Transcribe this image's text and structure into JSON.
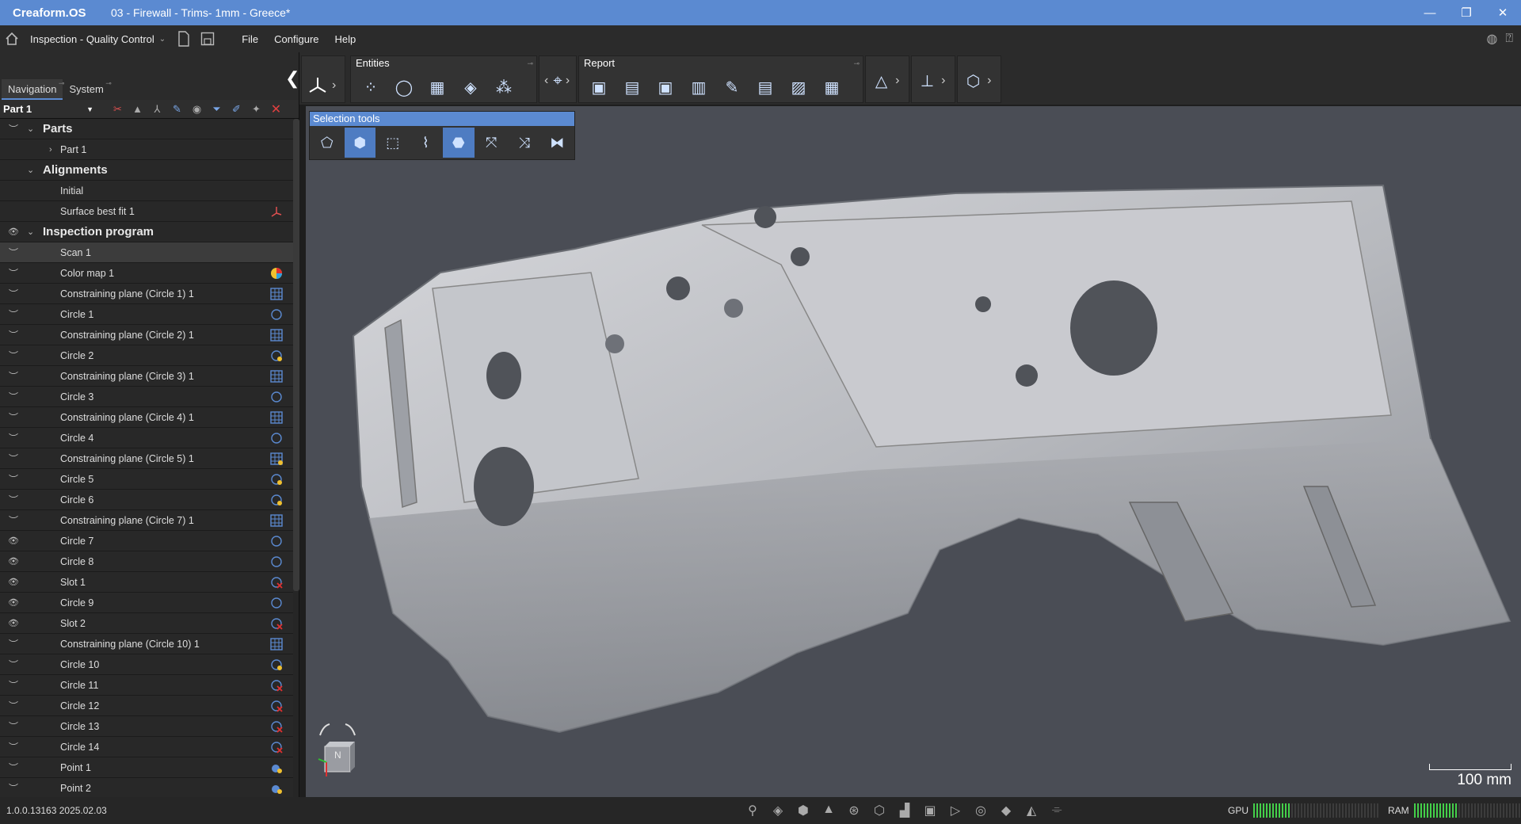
{
  "window": {
    "app_name": "Creaform.OS",
    "doc_title": "03 - Firewall - Trims- 1mm - Greece*",
    "minimize": "—",
    "maximize": "❐",
    "close": "✕"
  },
  "menubar": {
    "workspace": "Inspection - Quality Control",
    "items": [
      "File",
      "Configure",
      "Help"
    ]
  },
  "panel": {
    "tabs": [
      "Navigation",
      "System"
    ],
    "part_select": "Part 1"
  },
  "tree": [
    {
      "label": "Parts",
      "type": "group",
      "eye": "hidden",
      "chev": "down",
      "indent": 0
    },
    {
      "label": "Part 1",
      "type": "item",
      "eye": "none",
      "chev": "right",
      "indent": 1
    },
    {
      "label": "Alignments",
      "type": "group",
      "eye": "none",
      "chev": "down",
      "indent": 0
    },
    {
      "label": "Initial",
      "type": "item",
      "eye": "none",
      "indent": 1
    },
    {
      "label": "Surface best fit 1",
      "type": "item",
      "eye": "none",
      "indent": 1,
      "icon": "axes-icon"
    },
    {
      "label": "Inspection program",
      "type": "group",
      "eye": "visible",
      "chev": "down",
      "indent": 0
    },
    {
      "label": "Scan 1",
      "type": "item",
      "eye": "hidden",
      "indent": 1,
      "selected": true
    },
    {
      "label": "Color map 1",
      "type": "item",
      "eye": "hidden",
      "indent": 1,
      "icon": "color-map-icon"
    },
    {
      "label": "Constraining plane (Circle 1) 1",
      "type": "item",
      "eye": "hidden",
      "indent": 1,
      "icon": "plane-icon"
    },
    {
      "label": "Circle 1",
      "type": "item",
      "eye": "hidden",
      "indent": 1,
      "icon": "circle-icon"
    },
    {
      "label": "Constraining plane (Circle 2) 1",
      "type": "item",
      "eye": "hidden",
      "indent": 1,
      "icon": "plane-icon"
    },
    {
      "label": "Circle 2",
      "type": "item",
      "eye": "hidden",
      "indent": 1,
      "icon": "circle-warn-icon"
    },
    {
      "label": "Constraining plane (Circle 3) 1",
      "type": "item",
      "eye": "hidden",
      "indent": 1,
      "icon": "plane-icon"
    },
    {
      "label": "Circle 3",
      "type": "item",
      "eye": "hidden",
      "indent": 1,
      "icon": "circle-icon"
    },
    {
      "label": "Constraining plane (Circle 4) 1",
      "type": "item",
      "eye": "hidden",
      "indent": 1,
      "icon": "plane-icon"
    },
    {
      "label": "Circle 4",
      "type": "item",
      "eye": "hidden",
      "indent": 1,
      "icon": "circle-icon"
    },
    {
      "label": "Constraining plane (Circle 5) 1",
      "type": "item",
      "eye": "hidden",
      "indent": 1,
      "icon": "plane-warn-icon"
    },
    {
      "label": "Circle 5",
      "type": "item",
      "eye": "hidden",
      "indent": 1,
      "icon": "circle-warn-icon"
    },
    {
      "label": "Circle 6",
      "type": "item",
      "eye": "hidden",
      "indent": 1,
      "icon": "circle-warn-icon"
    },
    {
      "label": "Constraining plane (Circle 7) 1",
      "type": "item",
      "eye": "hidden",
      "indent": 1,
      "icon": "plane-icon"
    },
    {
      "label": "Circle 7",
      "type": "item",
      "eye": "visible",
      "indent": 1,
      "icon": "circle-icon"
    },
    {
      "label": "Circle 8",
      "type": "item",
      "eye": "visible",
      "indent": 1,
      "icon": "circle-icon"
    },
    {
      "label": "Slot 1",
      "type": "item",
      "eye": "visible",
      "indent": 1,
      "icon": "circle-error-icon"
    },
    {
      "label": "Circle 9",
      "type": "item",
      "eye": "visible",
      "indent": 1,
      "icon": "circle-icon"
    },
    {
      "label": "Slot 2",
      "type": "item",
      "eye": "visible",
      "indent": 1,
      "icon": "circle-error-icon"
    },
    {
      "label": "Constraining plane (Circle 10) 1",
      "type": "item",
      "eye": "hidden",
      "indent": 1,
      "icon": "plane-icon"
    },
    {
      "label": "Circle 10",
      "type": "item",
      "eye": "hidden",
      "indent": 1,
      "icon": "circle-warn-icon"
    },
    {
      "label": "Circle 11",
      "type": "item",
      "eye": "hidden",
      "indent": 1,
      "icon": "circle-error-icon"
    },
    {
      "label": "Circle 12",
      "type": "item",
      "eye": "hidden",
      "indent": 1,
      "icon": "circle-error-icon"
    },
    {
      "label": "Circle 13",
      "type": "item",
      "eye": "hidden",
      "indent": 1,
      "icon": "circle-error-icon"
    },
    {
      "label": "Circle 14",
      "type": "item",
      "eye": "hidden",
      "indent": 1,
      "icon": "circle-error-icon"
    },
    {
      "label": "Point 1",
      "type": "item",
      "eye": "hidden",
      "indent": 1,
      "icon": "point-icon"
    },
    {
      "label": "Point 2",
      "type": "item",
      "eye": "hidden",
      "indent": 1,
      "icon": "point-icon"
    }
  ],
  "toolbar": {
    "entities_title": "Entities",
    "report_title": "Report"
  },
  "selection_tools": {
    "title": "Selection tools"
  },
  "viewport": {
    "scale_label": "100 mm",
    "cube_label": "N"
  },
  "status": {
    "version": "1.0.0.13163 2025.02.03",
    "gpu_label": "GPU",
    "ram_label": "RAM",
    "gpu_level": 0.3,
    "ram_level": 0.35
  },
  "colors": {
    "accent": "#5b8ad1",
    "meter_on": "#44d04a",
    "viewport_bg": "#4a4d55"
  }
}
